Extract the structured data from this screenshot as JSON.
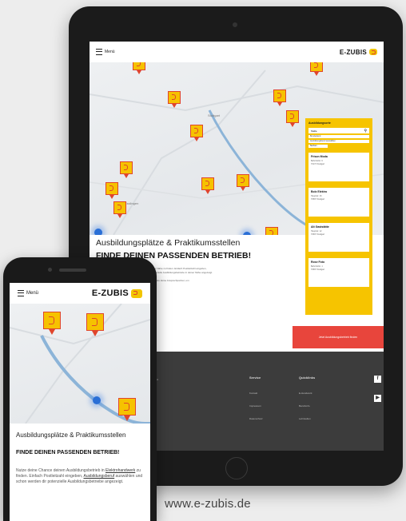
{
  "tablet": {
    "header": {
      "menu_label": "Menü",
      "logo_text": "E-ZUBIS"
    },
    "map_places": [
      "Stuttgart",
      "Esslingen"
    ],
    "panel": {
      "title": "Ausbildungsorte",
      "search_value": "Stelle",
      "select_1": "Bundesland",
      "select_2": "Ausbildungsberuf auswählen",
      "button": "Suchen",
      "results": [
        {
          "name": "Frison Moda",
          "line1": "Bahnhofstr. 6",
          "line2": "70173 Stuttgart"
        },
        {
          "name": "Bolz Elektro",
          "line1": "Hauptstr. 16",
          "line2": "70597 Stuttgart"
        },
        {
          "name": "Alt Gaststätte",
          "line1": "Hauptstr. 12",
          "line2": "70597 Stuttgart"
        },
        {
          "name": "Rose Foto",
          "line1": "Bahnhofstr. 1",
          "line2": "70597 Stuttgart"
        }
      ]
    },
    "headline": "Ausbildungsplätze & Praktikumsstellen",
    "subheadline": "FINDE DEINEN PASSENDEN BETRIEB!",
    "text_lines": [
      "Nutze deine Chance deinen Ausbildungsbetrieb in deiner Nähe zu finden. Einfach Postleitzahl eingeben,",
      "Ausbildungsberuf auswählen und schon werden dir potenzielle Ausbildungsbetriebe in deiner Nähe angezeigt.",
      "",
      "Klicke auf einen Betrieb und erhalte alle Kontaktdaten sowie deine Ansprechpartner, um",
      "dich direkt dort zu bewerben.",
      "",
      "Viel Erfolg bei deiner Ausbildungssuche!"
    ],
    "cta": "Jetzt Ausbildungsbetrieb finden",
    "footer": {
      "address": [
        "Postfach 10 24 44",
        "70020 Stuttgart"
      ],
      "service_heading": "Service",
      "service_links": [
        "Kontakt",
        "Impressum",
        "Datenschutz"
      ],
      "quicklinks_heading": "Quicklinks",
      "quick_links": [
        "E-Handwerk",
        "Berufsinfo",
        "Lehrstellen"
      ]
    }
  },
  "phone": {
    "header": {
      "menu_label": "Menü",
      "logo_text": "E-ZUBIS"
    },
    "headline": "Ausbildungsplätze & Praktikumsstellen",
    "subheadline": "FINDE DEINEN PASSENDEN BETRIEB!",
    "text_pre": "Nutze deine Chance deinen Ausbildungsbetrieb in ",
    "text_link1": "Elektrohandwerk",
    "text_mid": " zu finden. Einfach Postleitzahl eingeben, ",
    "text_link2": "Ausbildungsberuf",
    "text_post": " auswählen und schon werden dir potenzielle Ausbildungsbetriebe angezeigt."
  },
  "website_url": "www.e-zubis.de",
  "colors": {
    "brand_yellow": "#f6c400",
    "brand_red": "#e0452c",
    "footer": "#3c3c3c"
  }
}
